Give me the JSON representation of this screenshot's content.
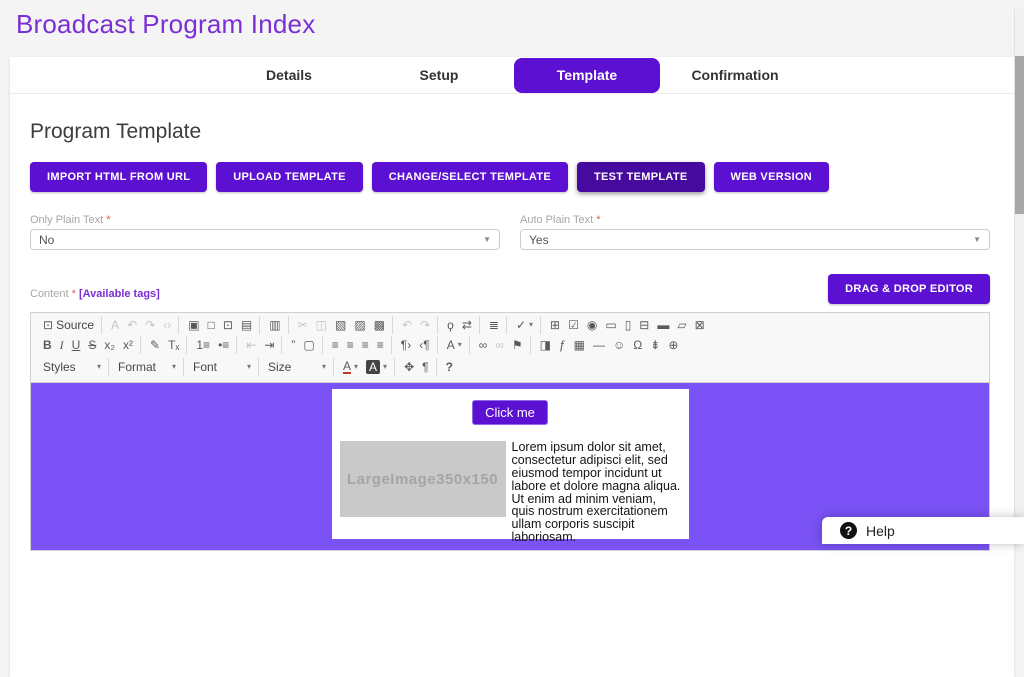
{
  "page": {
    "title": "Broadcast Program Index"
  },
  "tabs": [
    {
      "id": "details",
      "label": "Details",
      "active": false
    },
    {
      "id": "setup",
      "label": "Setup",
      "active": false
    },
    {
      "id": "template",
      "label": "Template",
      "active": true
    },
    {
      "id": "confirmation",
      "label": "Confirmation",
      "active": false
    }
  ],
  "template_section": {
    "heading": "Program Template",
    "actions": [
      {
        "id": "import-html-from-url",
        "label": "IMPORT HTML FROM URL",
        "pressed": false
      },
      {
        "id": "upload-template",
        "label": "UPLOAD TEMPLATE",
        "pressed": false
      },
      {
        "id": "change-select-template",
        "label": "CHANGE/SELECT TEMPLATE",
        "pressed": false
      },
      {
        "id": "test-template",
        "label": "TEST TEMPLATE",
        "pressed": true
      },
      {
        "id": "web-version",
        "label": "WEB VERSION",
        "pressed": false
      }
    ]
  },
  "fields": {
    "only_plain_text": {
      "label": "Only Plain Text",
      "required_mark": "*",
      "value": "No"
    },
    "auto_plain_text": {
      "label": "Auto Plain Text",
      "required_mark": "*",
      "value": "Yes"
    }
  },
  "content_row": {
    "label": "Content",
    "required_mark": "*",
    "available_tags": "[Available tags]",
    "drag_drop_button": "DRAG & DROP EDITOR"
  },
  "editor": {
    "toolbar": [
      [
        [
          {
            "name": "source",
            "glyph": "⊡",
            "label": "Source"
          }
        ],
        [
          {
            "name": "search-code",
            "glyph": "A",
            "disabled": true
          },
          {
            "name": "auto-format",
            "glyph": "↶",
            "disabled": true
          },
          {
            "name": "comment",
            "glyph": "↷",
            "disabled": true
          },
          {
            "name": "uncomment",
            "glyph": "‹›",
            "disabled": true
          }
        ],
        [
          {
            "name": "save",
            "glyph": "▣"
          },
          {
            "name": "new-page",
            "glyph": "□"
          },
          {
            "name": "preview",
            "glyph": "⊡"
          },
          {
            "name": "print",
            "glyph": "▤"
          }
        ],
        [
          {
            "name": "templates",
            "glyph": "▥"
          }
        ],
        [
          {
            "name": "cut",
            "glyph": "✂",
            "disabled": true
          },
          {
            "name": "copy",
            "glyph": "◫",
            "disabled": true
          },
          {
            "name": "paste",
            "glyph": "▧"
          },
          {
            "name": "paste-text",
            "glyph": "▨"
          },
          {
            "name": "paste-word",
            "glyph": "▩"
          }
        ],
        [
          {
            "name": "undo",
            "glyph": "↶",
            "disabled": true
          },
          {
            "name": "redo",
            "glyph": "↷",
            "disabled": true
          }
        ],
        [
          {
            "name": "find",
            "glyph": "ϙ"
          },
          {
            "name": "replace",
            "glyph": "⇄"
          }
        ],
        [
          {
            "name": "select-all",
            "glyph": "≣"
          }
        ],
        [
          {
            "name": "spell-check",
            "glyph": "✓",
            "caret": true
          }
        ],
        [
          {
            "name": "form",
            "glyph": "⊞"
          },
          {
            "name": "checkbox",
            "glyph": "☑"
          },
          {
            "name": "radio",
            "glyph": "◉"
          },
          {
            "name": "text-field",
            "glyph": "▭"
          },
          {
            "name": "textarea",
            "glyph": "▯"
          },
          {
            "name": "select-field",
            "glyph": "⊟"
          },
          {
            "name": "button-field",
            "glyph": "▬"
          },
          {
            "name": "image-button",
            "glyph": "▱"
          },
          {
            "name": "hidden-field",
            "glyph": "⊠"
          }
        ]
      ],
      [
        [
          {
            "name": "bold",
            "glyph": "B",
            "cls": "fb"
          },
          {
            "name": "italic",
            "glyph": "I",
            "cls": "fi"
          },
          {
            "name": "underline",
            "glyph": "U",
            "cls": "fu"
          },
          {
            "name": "strikethrough",
            "glyph": "S",
            "cls": "fs"
          },
          {
            "name": "subscript",
            "glyph": "x₂"
          },
          {
            "name": "superscript",
            "glyph": "x²"
          }
        ],
        [
          {
            "name": "copy-formatting",
            "glyph": "✎"
          },
          {
            "name": "remove-format",
            "glyph": "Tₓ"
          }
        ],
        [
          {
            "name": "numbered-list",
            "glyph": "1≡"
          },
          {
            "name": "bulleted-list",
            "glyph": "•≡"
          }
        ],
        [
          {
            "name": "outdent",
            "glyph": "⇤",
            "disabled": true
          },
          {
            "name": "indent",
            "glyph": "⇥"
          }
        ],
        [
          {
            "name": "blockquote",
            "glyph": "”"
          },
          {
            "name": "div-container",
            "glyph": "▢"
          }
        ],
        [
          {
            "name": "align-left",
            "glyph": "≡"
          },
          {
            "name": "align-center",
            "glyph": "≡"
          },
          {
            "name": "align-right",
            "glyph": "≡"
          },
          {
            "name": "justify",
            "glyph": "≡"
          }
        ],
        [
          {
            "name": "bidi-ltr",
            "glyph": "¶›"
          },
          {
            "name": "bidi-rtl",
            "glyph": "‹¶"
          }
        ],
        [
          {
            "name": "language",
            "glyph": "A",
            "caret": true
          }
        ],
        [
          {
            "name": "link",
            "glyph": "∞"
          },
          {
            "name": "unlink",
            "glyph": "∞",
            "disabled": true
          },
          {
            "name": "anchor",
            "glyph": "⚑"
          }
        ],
        [
          {
            "name": "image",
            "glyph": "◨"
          },
          {
            "name": "flash",
            "glyph": "ƒ"
          },
          {
            "name": "table",
            "glyph": "▦"
          },
          {
            "name": "horizontal-rule",
            "glyph": "—"
          },
          {
            "name": "smiley",
            "glyph": "☺"
          },
          {
            "name": "special-char",
            "glyph": "Ω"
          },
          {
            "name": "page-break",
            "glyph": "⇟"
          },
          {
            "name": "iframe",
            "glyph": "⊕"
          }
        ]
      ],
      [
        [
          {
            "name": "styles",
            "type": "dropdown",
            "label": "Styles"
          }
        ],
        [
          {
            "name": "format",
            "type": "dropdown",
            "label": "Format"
          }
        ],
        [
          {
            "name": "font",
            "type": "dropdown",
            "label": "Font"
          }
        ],
        [
          {
            "name": "size",
            "type": "dropdown",
            "label": "Size"
          }
        ],
        [
          {
            "name": "text-color",
            "glyph": "A",
            "cls": "tc",
            "caret": true
          },
          {
            "name": "bg-color",
            "glyph": "A",
            "cls": "bc",
            "caret": true
          }
        ],
        [
          {
            "name": "maximize",
            "glyph": "✥"
          },
          {
            "name": "show-blocks",
            "glyph": "¶"
          }
        ],
        [
          {
            "name": "about",
            "glyph": "?",
            "cls": "fb"
          }
        ]
      ]
    ],
    "canvas": {
      "button_label": "Click me",
      "image_placeholder": "LargeImage350x150",
      "paragraph": "Lorem ipsum dolor sit amet, consectetur adipisci elit, sed eiusmod tempor incidunt ut labore et dolore magna aliqua. Ut enim ad minim veniam, quis nostrum exercitationem ullam corporis suscipit laboriosam."
    }
  },
  "help": {
    "icon": "?",
    "label": "Help"
  },
  "colors": {
    "primary": "#5c10d2",
    "primary_dark": "#470a9e",
    "title": "#7a2fd4",
    "canvas": "#7a52f5",
    "required": "#e05a50",
    "link": "#7a2fd4"
  }
}
